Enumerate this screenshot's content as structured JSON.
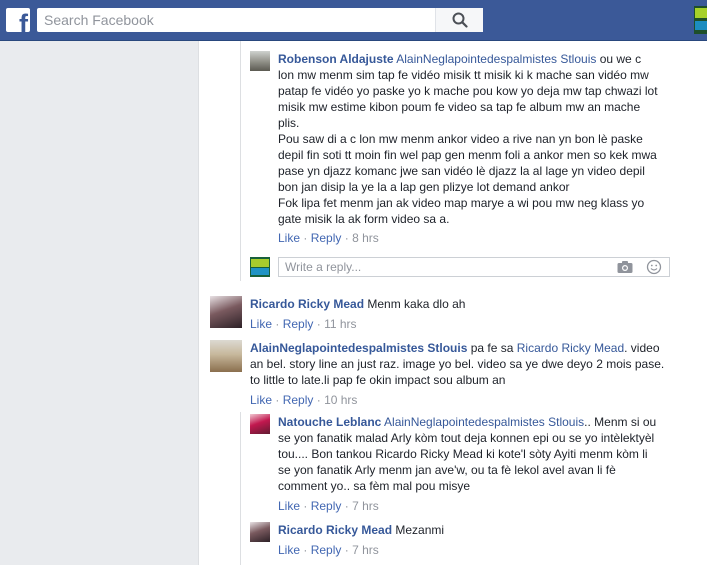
{
  "header": {
    "search_placeholder": "Search Facebook",
    "logo_letter": "f"
  },
  "comments": {
    "robenson": {
      "author": "Robenson Aldajuste",
      "mention": "AlainNeglapointedespalmistes Stlouis",
      "lines": [
        " ou we c",
        "lon mw menm sim tap fe vidéo misik tt misik ki k mache san vidéo mw",
        "patap fe vidéo yo paske yo k mache pou kow yo deja mw tap chwazi lot",
        "misik mw estime kibon poum fe video sa tap fe album mw an mache",
        "plis.",
        "Pou saw di a c lon mw menm ankor video a rive nan yn bon lè paske",
        "depil fin soti tt moin fin wel pap gen menm foli a ankor men so kek mwa",
        "pase yn djazz komanc jwe san vidéo lè djazz la al lage yn video depil",
        "bon jan disip la ye la a lap gen plizye lot demand ankor",
        "Fok lipa fet menm jan ak video map marye a wi pou mw neg klass yo",
        "gate misik la ak form video sa a."
      ],
      "like": "Like",
      "reply": "Reply",
      "time": "8 hrs"
    },
    "reply_box_placeholder": "Write a reply...",
    "ricardo1": {
      "author": "Ricardo Ricky Mead",
      "text": " Menm kaka dlo ah",
      "like": "Like",
      "reply": "Reply",
      "time": "11 hrs"
    },
    "alain": {
      "author": "AlainNeglapointedespalmistes Stlouis",
      "text_pre": " pa fe sa ",
      "mention": "Ricardo Ricky Mead",
      "line1_end": ". video",
      "lines": [
        "an bel. story line an just raz. image yo bel. video sa ye dwe deyo 2 mois pase.",
        "to little to late.li pap fe okin impact sou album an"
      ],
      "like": "Like",
      "reply": "Reply",
      "time": "10 hrs"
    },
    "natouche": {
      "author": "Natouche Leblanc",
      "mention": "AlainNeglapointedespalmistes Stlouis",
      "line1_end": ".. Menm si ou",
      "lines": [
        "se yon fanatik malad Arly kòm tout deja konnen epi ou se yo intèlektyèl",
        "tou.... Bon tankou Ricardo Ricky Mead ki kote'l sòty Ayiti menm kòm li",
        "se yon fanatik Arly menm jan ave'w, ou ta fè lekol avel avan li fè",
        "comment yo.. sa fèm mal pou misye"
      ],
      "like": "Like",
      "reply": "Reply",
      "time": "7 hrs"
    },
    "ricardo2": {
      "author": "Ricardo Ricky Mead",
      "text": " Mezanmi",
      "like": "Like",
      "reply": "Reply",
      "time": "7 hrs"
    },
    "separator": "·"
  },
  "colors": {
    "brand": "#3b5998",
    "link": "#365899",
    "action_link": "#4267b2",
    "meta": "#90949c",
    "background": "#e9ebee"
  },
  "icons": [
    "facebook-logo-icon",
    "search-icon",
    "camera-icon",
    "smiley-icon"
  ]
}
